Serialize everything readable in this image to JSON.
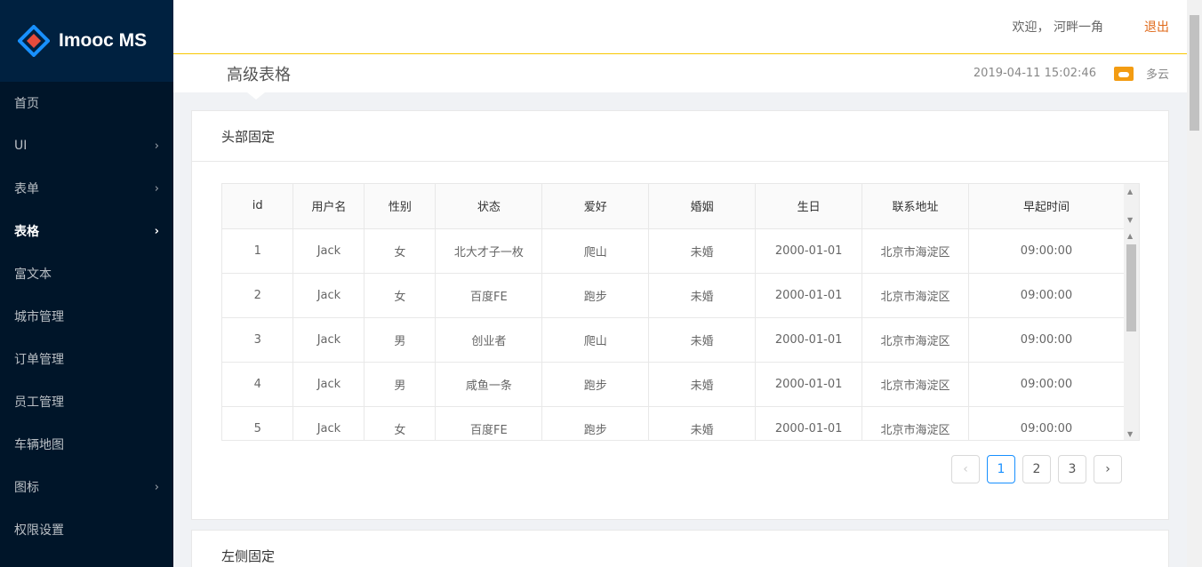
{
  "app": {
    "logo_text": "Imooc MS"
  },
  "sidebar": {
    "items": [
      {
        "label": "首页",
        "has_children": false
      },
      {
        "label": "UI",
        "has_children": true
      },
      {
        "label": "表单",
        "has_children": true
      },
      {
        "label": "表格",
        "has_children": true,
        "active": true
      },
      {
        "label": "富文本",
        "has_children": false
      },
      {
        "label": "城市管理",
        "has_children": false
      },
      {
        "label": "订单管理",
        "has_children": false
      },
      {
        "label": "员工管理",
        "has_children": false
      },
      {
        "label": "车辆地图",
        "has_children": false
      },
      {
        "label": "图标",
        "has_children": true
      },
      {
        "label": "权限设置",
        "has_children": false
      }
    ]
  },
  "header": {
    "welcome": "欢迎，  河畔一角",
    "logout": "退出",
    "page_title": "高级表格",
    "datetime": "2019-04-11 15:02:46",
    "weather": "多云",
    "weather_icon": "cloud-sun-icon",
    "accent_color": "#f9c700"
  },
  "card1": {
    "title": "头部固定",
    "columns": [
      "id",
      "用户名",
      "性别",
      "状态",
      "爱好",
      "婚姻",
      "生日",
      "联系地址",
      "早起时间"
    ],
    "rows": [
      [
        "1",
        "Jack",
        "女",
        "北大才子一枚",
        "爬山",
        "未婚",
        "2000-01-01",
        "北京市海淀区",
        "09:00:00"
      ],
      [
        "2",
        "Jack",
        "女",
        "百度FE",
        "跑步",
        "未婚",
        "2000-01-01",
        "北京市海淀区",
        "09:00:00"
      ],
      [
        "3",
        "Jack",
        "男",
        "创业者",
        "爬山",
        "未婚",
        "2000-01-01",
        "北京市海淀区",
        "09:00:00"
      ],
      [
        "4",
        "Jack",
        "男",
        "咸鱼一条",
        "跑步",
        "未婚",
        "2000-01-01",
        "北京市海淀区",
        "09:00:00"
      ],
      [
        "5",
        "Jack",
        "女",
        "百度FE",
        "跑步",
        "未婚",
        "2000-01-01",
        "北京市海淀区",
        "09:00:00"
      ]
    ],
    "pagination": {
      "prev": "‹",
      "pages": [
        "1",
        "2",
        "3"
      ],
      "current": "1",
      "next": "›"
    }
  },
  "card2": {
    "title": "左侧固定"
  }
}
